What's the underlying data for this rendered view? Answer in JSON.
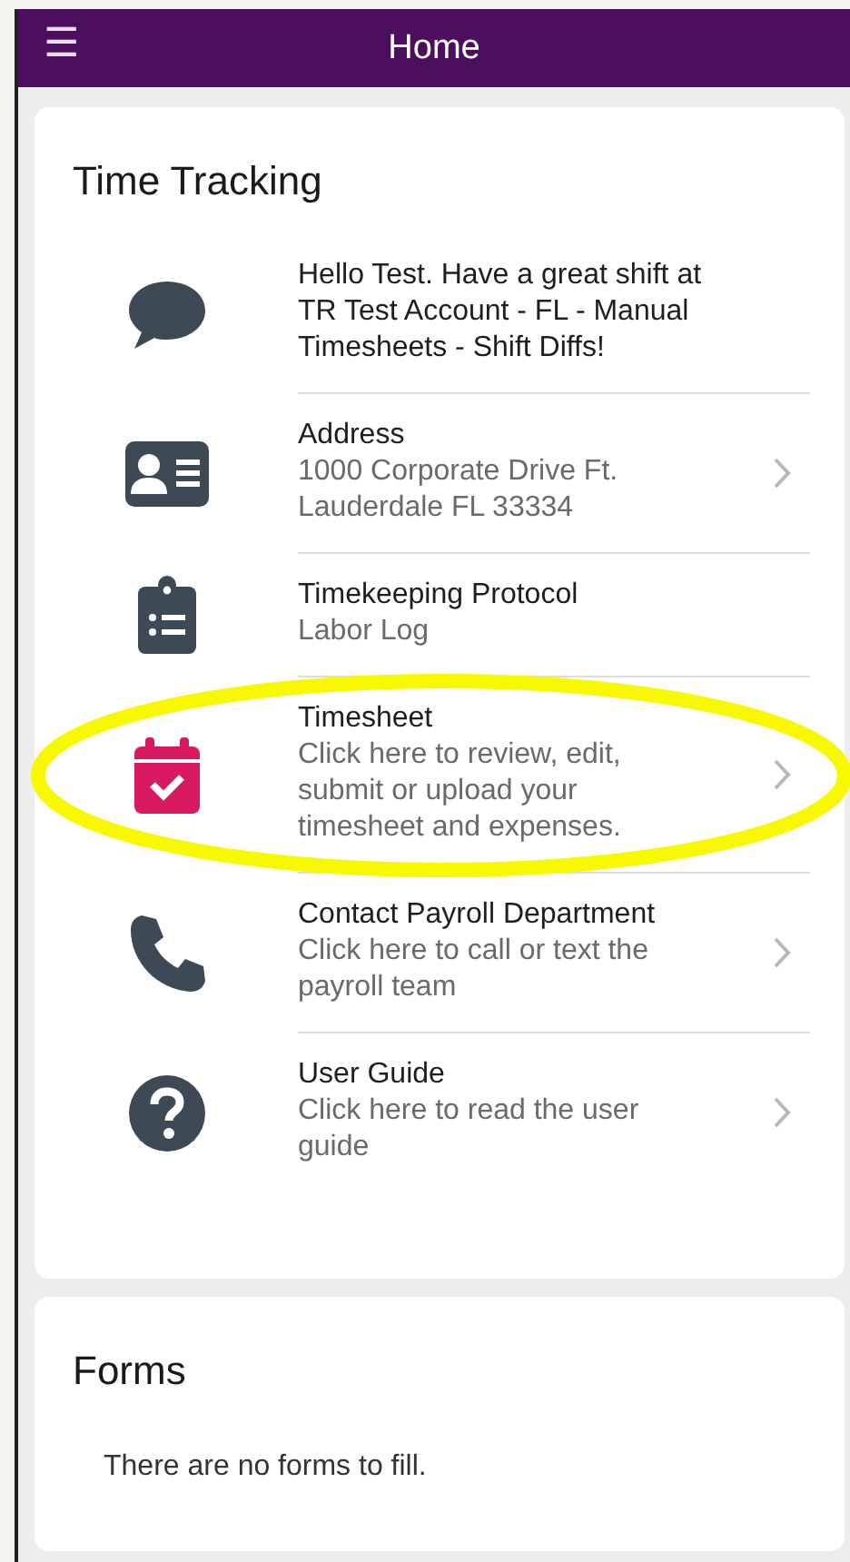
{
  "header": {
    "menu_glyph": "☰",
    "title": "Home"
  },
  "time_tracking": {
    "title": "Time Tracking",
    "items": [
      {
        "kind": "chat",
        "color": "#3d4a55",
        "title": "Hello Test. Have a great shift at TR Test Account - FL - Manual Timesheets - Shift Diffs!",
        "chevron": false,
        "circled": false
      },
      {
        "kind": "id-card",
        "color": "#3d4a55",
        "title": "Address",
        "subtitle": "1000 Corporate Drive Ft. Lauderdale FL 33334",
        "chevron": true,
        "circled": false
      },
      {
        "kind": "clipboard",
        "color": "#3d4a55",
        "title": "Timekeeping Protocol",
        "subtitle": "Labor Log",
        "chevron": false,
        "circled": false
      },
      {
        "kind": "calendar",
        "color": "#d81b60",
        "title": "Timesheet",
        "subtitle": "Click here to review, edit, submit or upload your timesheet and expenses.",
        "chevron": true,
        "circled": true
      },
      {
        "kind": "phone",
        "color": "#3d4a55",
        "title": "Contact Payroll Department",
        "subtitle": "Click here to call or text the payroll team",
        "chevron": true,
        "circled": false
      },
      {
        "kind": "help",
        "color": "#3d4a55",
        "title": "User Guide",
        "subtitle": "Click here to read the user guide",
        "chevron": true,
        "circled": false
      }
    ]
  },
  "forms": {
    "title": "Forms",
    "empty_text": "There are no forms to fill."
  }
}
